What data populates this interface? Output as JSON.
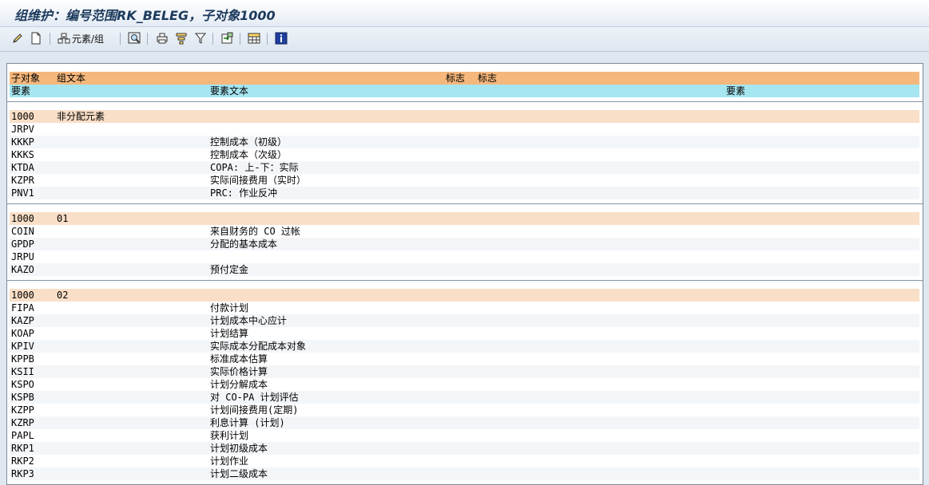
{
  "window": {
    "title": "组维护：编号范围RK_BELEG，子对象1000"
  },
  "toolbar": {
    "edit_icon": "pencil-icon",
    "new_icon": "new-document-icon",
    "elements_groups_label": "元素/组",
    "find_icon": "find-icon",
    "print_icon": "print-icon",
    "sort_icon": "sort-icon",
    "filter_icon": "filter-icon",
    "export_icon": "export-icon",
    "layout_icon": "grid-layout-icon",
    "info_icon": "info-icon"
  },
  "header": {
    "subobject": "子对象",
    "group_text": "组文本",
    "flag1": "标志",
    "flag2": "标志",
    "element": "要素",
    "element_text": "要素文本",
    "element2": "要素"
  },
  "groups": [
    {
      "subobject": "1000",
      "name": "非分配元素",
      "rows": [
        {
          "code": "JRPV",
          "text": ""
        },
        {
          "code": "KKKP",
          "text": "控制成本（初级）"
        },
        {
          "code": "KKKS",
          "text": "控制成本（次级）"
        },
        {
          "code": "KTDA",
          "text": "COPA: 上-下：实际"
        },
        {
          "code": "KZPR",
          "text": "实际间接费用（实时）"
        },
        {
          "code": "PNV1",
          "text": "PRC: 作业反冲"
        }
      ]
    },
    {
      "subobject": "1000",
      "name": "01",
      "rows": [
        {
          "code": "COIN",
          "text": "来自财务的 CO 过帐"
        },
        {
          "code": "GPDP",
          "text": "分配的基本成本"
        },
        {
          "code": "JRPU",
          "text": ""
        },
        {
          "code": "KAZO",
          "text": "预付定金"
        }
      ]
    },
    {
      "subobject": "1000",
      "name": "02",
      "rows": [
        {
          "code": "FIPA",
          "text": "付款计划"
        },
        {
          "code": "KAZP",
          "text": "计划成本中心应计"
        },
        {
          "code": "KOAP",
          "text": "计划结算"
        },
        {
          "code": "KPIV",
          "text": "实际成本分配成本对象"
        },
        {
          "code": "KPPB",
          "text": "标准成本估算"
        },
        {
          "code": "KSII",
          "text": "实际价格计算"
        },
        {
          "code": "KSPO",
          "text": "计划分解成本"
        },
        {
          "code": "KSPB",
          "text": "对 CO-PA 计划评估"
        },
        {
          "code": "KZPP",
          "text": "计划间接费用(定期)"
        },
        {
          "code": "KZRP",
          "text": "利息计算 (计划)"
        },
        {
          "code": "PAPL",
          "text": "获利计划"
        },
        {
          "code": "RKP1",
          "text": "计划初级成本"
        },
        {
          "code": "RKP2",
          "text": "计划作业"
        },
        {
          "code": "RKP3",
          "text": "计划二级成本"
        }
      ]
    }
  ]
}
